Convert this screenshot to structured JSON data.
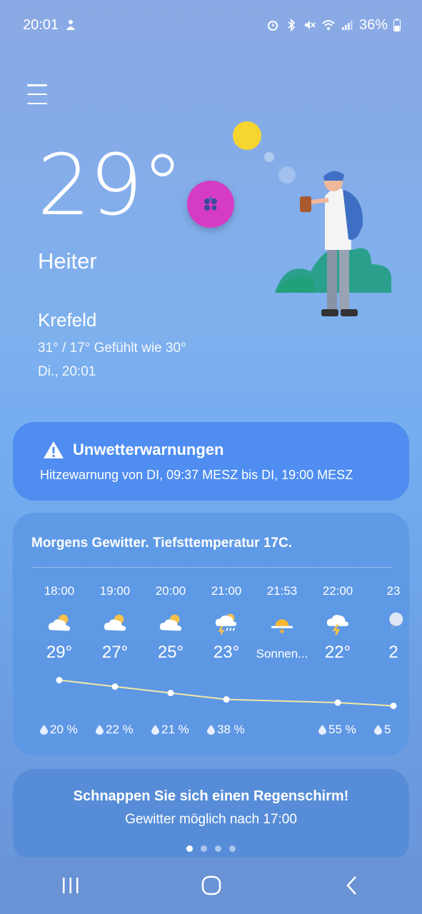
{
  "status_bar": {
    "time": "20:01",
    "battery": "36%",
    "icons": [
      "notification-person-icon",
      "alarm-icon",
      "bluetooth-icon",
      "mute-icon",
      "wifi-icon",
      "signal-icon",
      "battery-icon"
    ]
  },
  "current": {
    "temperature": "29°",
    "condition": "Heiter",
    "location": "Krefeld",
    "minmax_feels": "31° / 17° Gefühlt wie 30°",
    "datetime": "Di., 20:01"
  },
  "warning": {
    "title": "Unwetterwarnungen",
    "text": "Hitzewarnung von DI, 09:37 MESZ bis DI, 19:00 MESZ"
  },
  "forecast": {
    "summary": "Morgens Gewitter. Tiefsttemperatur 17C.",
    "hours": [
      {
        "time": "18:00",
        "icon": "partly-cloudy-icon",
        "temp": "29°",
        "precip": "20 %"
      },
      {
        "time": "19:00",
        "icon": "partly-cloudy-icon",
        "temp": "27°",
        "precip": "22 %"
      },
      {
        "time": "20:00",
        "icon": "partly-cloudy-icon",
        "temp": "25°",
        "precip": "21 %"
      },
      {
        "time": "21:00",
        "icon": "thunderstorm-icon",
        "temp": "23°",
        "precip": "38 %"
      },
      {
        "time": "21:53",
        "icon": "sunset-icon",
        "temp": "Sonnen...",
        "precip": ""
      },
      {
        "time": "22:00",
        "icon": "thunder-cloud-icon",
        "temp": "22°",
        "precip": "55 %"
      },
      {
        "time": "23",
        "icon": "night-cloud-icon",
        "temp": "2",
        "precip": "5"
      }
    ]
  },
  "tip": {
    "title": "Schnappen Sie sich einen Regenschirm!",
    "text": "Gewitter möglich nach 17:00",
    "page_count": 4,
    "active_page": 1
  },
  "colors": {
    "warning_card": "#4f8df0",
    "fab": "#d63bc4",
    "sun": "#f7d531",
    "graph_line": "#f3e7a6"
  }
}
